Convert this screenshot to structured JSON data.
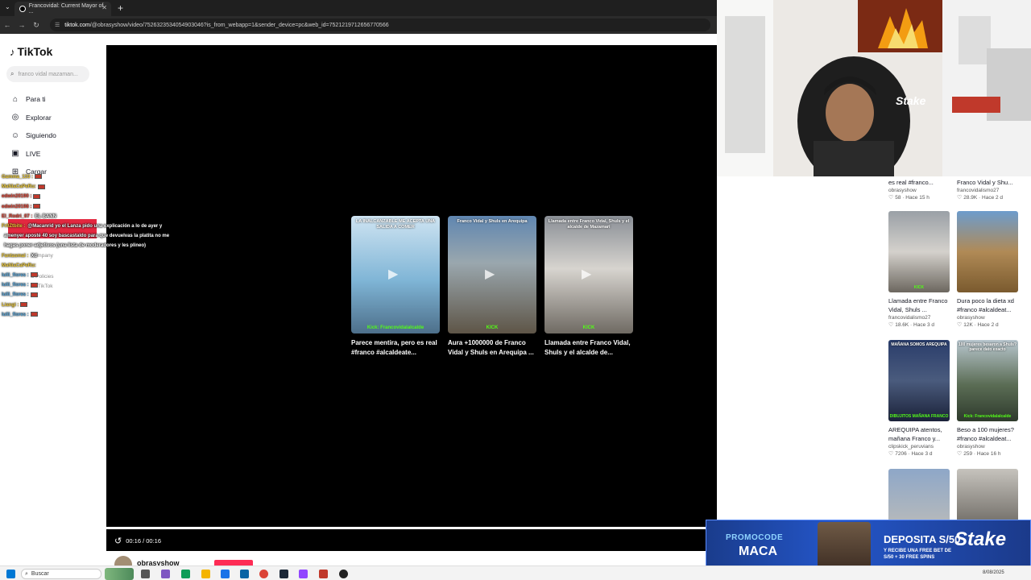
{
  "browser": {
    "tab_title": "Francovidal: Current Mayor of ...",
    "url_host": "tiktok.com",
    "url_path": "/@obrasyshow/video/7526323534054903046?is_from_webapp=1&sender_device=pc&web_id=7521219712656770566"
  },
  "sidebar": {
    "logo": "TikTok",
    "search_placeholder": "franco vidal mazaman...",
    "items": [
      {
        "label": "Para ti",
        "icon": "home-icon"
      },
      {
        "label": "Explorar",
        "icon": "compass-icon"
      },
      {
        "label": "Siguiendo",
        "icon": "following-icon"
      },
      {
        "label": "LIVE",
        "icon": "live-icon"
      },
      {
        "label": "Cargar",
        "icon": "upload-icon"
      }
    ],
    "footer_company": "Company",
    "footer_policies": "& Policies",
    "footer_copyright": "25 TikTok"
  },
  "chat": [
    {
      "user": "Gamma_133 :",
      "color": "yellow",
      "flag": true,
      "msg": ""
    },
    {
      "user": "MaNiaCaPeRu:",
      "color": "yellow",
      "flag": true,
      "msg": ""
    },
    {
      "user": "edwin20190 :",
      "color": "red",
      "flag": true,
      "msg": ""
    },
    {
      "user": "edwin20198 :",
      "color": "red",
      "flag": true,
      "msg": ""
    },
    {
      "user": "El_Rodri_07 :",
      "color": "red",
      "flag": false,
      "msg": "EL BANN"
    },
    {
      "user": "Fr0Ztbite :",
      "color": "yellow",
      "flag": false,
      "msg": "@Macanrid yo el Lanza pido una explicación a lo de ayer y"
    },
    {
      "user": "",
      "color": "yellow",
      "flag": false,
      "msg": "amenyer aposté 40 soy bascastaldo para que devuelvas la platita no me"
    },
    {
      "user": "",
      "color": "yellow",
      "flag": false,
      "msg": "hagas poner adjetivos (una lista de moderadores y les plineo)"
    },
    {
      "user": "Fantasmal :",
      "color": "yellow",
      "flag": false,
      "msg": "Xd"
    },
    {
      "user": "MaNiaCaPeRu:",
      "color": "yellow",
      "flag": false,
      "msg": ""
    },
    {
      "user": "lulli_flores :",
      "color": "blue",
      "flag": true,
      "msg": ""
    },
    {
      "user": "lulli_flores :",
      "color": "blue",
      "flag": true,
      "msg": ""
    },
    {
      "user": "lulli_flores :",
      "color": "blue",
      "flag": true,
      "msg": ""
    },
    {
      "user": "Liangi :",
      "color": "yellow",
      "flag": true,
      "msg": ""
    },
    {
      "user": "lulli_flores :",
      "color": "blue",
      "flag": true,
      "msg": ""
    }
  ],
  "video": {
    "time": "00:16 / 00:16",
    "author": "obrasyshow",
    "thumbs": [
      {
        "banner": "LA INALCANZABLE ME ACEPTA UNA SALIDA A COMER",
        "kick": "Kick: Francovidalalcalde",
        "caption": "Parece mentira, pero es real #franco #alcaldeate...",
        "bg": "linear-gradient(180deg,#cfe4f2 0%,#7fb5d6 55%,#4d6f8a 100%)"
      },
      {
        "banner": "Franco Vidal y Shuls en Arequipa",
        "kick": "KICK",
        "caption": "Aura +1000000 de Franco Vidal y Shuls en Arequipa ...",
        "bg": "linear-gradient(180deg,#5f86b0 0%,#9aa7ae 40%,#5e5547 100%)"
      },
      {
        "banner": "Llamada entre Franco Vidal, Shuls y el alcalde de Mazamari",
        "kick": "KICK",
        "caption": "Llamada entre Franco Vidal, Shuls y el alcalde de...",
        "bg": "linear-gradient(180deg,#8a8f96 0%,#d7d4cf 45%,#6f6a63 100%)"
      }
    ]
  },
  "grid": {
    "left": [
      {
        "caption": "es real #franco...",
        "author": "obrasyshow",
        "likes": "58",
        "time": "Hace 15 h",
        "img": false
      },
      {
        "caption": "Llamada entre Franco Vidal, Shuls ...",
        "author": "francovidalismo27",
        "likes": "18.6K",
        "time": "Hace 3 d",
        "img": true,
        "banner": "",
        "kick": "KICK",
        "bg": "linear-gradient(180deg,#9aa0a6 0%,#d4d1cc 50%,#6c675f 100%)"
      },
      {
        "caption": "AREQUIPA atentos, mañana Franco y...",
        "author": "clipskick_peruvians",
        "likes": "7206",
        "time": "Hace 3 d",
        "img": true,
        "banner": "MAÑANA SOMOS AREQUIPA",
        "kick": "DIBUJITOS MAÑANA FRANCO",
        "bg": "linear-gradient(180deg,#2a3d6b 0%,#4a5b7d 50%,#1b2239 100%)"
      },
      {
        "caption": "",
        "author": "",
        "likes": "",
        "time": "",
        "img": true,
        "banner": "",
        "kick": "",
        "bg": "linear-gradient(180deg,#8ea7c8 0%,#c9c2b5 100%)"
      }
    ],
    "right": [
      {
        "caption": "Franco Vidal y Shu...",
        "author": "francovidalismo27",
        "likes": "28.9K",
        "time": "Hace 2 d",
        "img": false
      },
      {
        "caption": "Dura poco la dieta xd #franco #alcaldeat...",
        "author": "obrasyshow",
        "likes": "12K",
        "time": "Hace 2 d",
        "img": true,
        "banner": "",
        "kick": "",
        "bg": "linear-gradient(180deg,#6d9ccc 0%,#b08a56 50%,#7a5a2e 100%)"
      },
      {
        "caption": "Beso a 100 mujeres? #franco #alcaldeat...",
        "author": "obrasyshow",
        "likes": "259",
        "time": "Hace 16 h",
        "img": true,
        "banner": "100 mujeres besaron a Shuls? parece dato exacto",
        "kick": "Kick: Francovidalalcalde",
        "bg": "linear-gradient(180deg,#b9c7cf 0%,#5b6d55 55%,#2e3a2c 100%)"
      },
      {
        "caption": "",
        "author": "",
        "likes": "",
        "time": "",
        "img": true,
        "banner": "",
        "kick": "",
        "bg": "linear-gradient(180deg,#c6c3bd 0%,#4a4640 100%)"
      }
    ]
  },
  "promo": {
    "code_label": "PROMOCODE",
    "code": "MACA",
    "deposit": "DEPOSITA S/50",
    "bonus": "Y RECIBE UNA FREE BET DE S/50 + 30 FREE SPINS",
    "brand": "Stake"
  },
  "taskbar": {
    "search": "Buscar",
    "date": "8/08/2025"
  }
}
